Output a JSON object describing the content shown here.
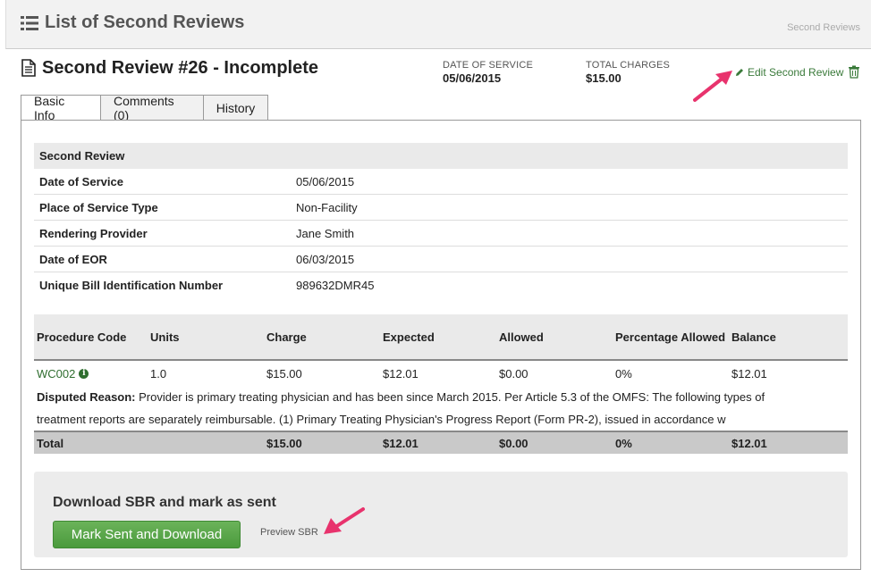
{
  "header": {
    "title": "List of Second Reviews",
    "breadcrumb": "Second Reviews"
  },
  "review": {
    "title": "Second Review #26 - Incomplete",
    "date_of_service_label": "DATE OF SERVICE",
    "date_of_service_value": "05/06/2015",
    "total_charges_label": "TOTAL CHARGES",
    "total_charges_value": "$15.00",
    "edit_label": "Edit Second Review"
  },
  "tabs": [
    {
      "label": "Basic Info",
      "active": true
    },
    {
      "label": "Comments (0)",
      "active": false
    },
    {
      "label": "History",
      "active": false
    }
  ],
  "info": {
    "heading": "Second Review",
    "rows": [
      {
        "key": "Date of Service",
        "value": "05/06/2015"
      },
      {
        "key": "Place of Service Type",
        "value": "Non-Facility"
      },
      {
        "key": "Rendering Provider",
        "value": "Jane Smith"
      },
      {
        "key": "Date of EOR",
        "value": "06/03/2015"
      },
      {
        "key": "Unique Bill Identification Number",
        "value": "989632DMR45"
      }
    ]
  },
  "procedures": {
    "columns": [
      "Procedure Code",
      "Units",
      "Charge",
      "Expected",
      "Allowed",
      "Percentage Allowed",
      "Balance"
    ],
    "rows": [
      {
        "code": "WC002",
        "units": "1.0",
        "charge": "$15.00",
        "expected": "$12.01",
        "allowed": "$0.00",
        "percentage": "0%",
        "balance": "$12.01"
      }
    ],
    "disputed_label": "Disputed Reason:",
    "disputed_line1": " Provider is primary treating physician and has been since March 2015. Per Article 5.3 of the OMFS: The following types of",
    "disputed_line2": "treatment reports are separately reimbursable. (1) Primary Treating Physician's Progress Report (Form PR-2), issued in accordance w",
    "total": {
      "label": "Total",
      "charge": "$15.00",
      "expected": "$12.01",
      "allowed": "$0.00",
      "percentage": "0%",
      "balance": "$12.01"
    }
  },
  "download": {
    "title": "Download SBR and mark as sent",
    "button_label": "Mark Sent and Download",
    "preview_label": "Preview SBR"
  },
  "colors": {
    "accent_green": "#4a9a3c",
    "link_green": "#2f6e2f",
    "arrow_pink": "#e8336d"
  }
}
